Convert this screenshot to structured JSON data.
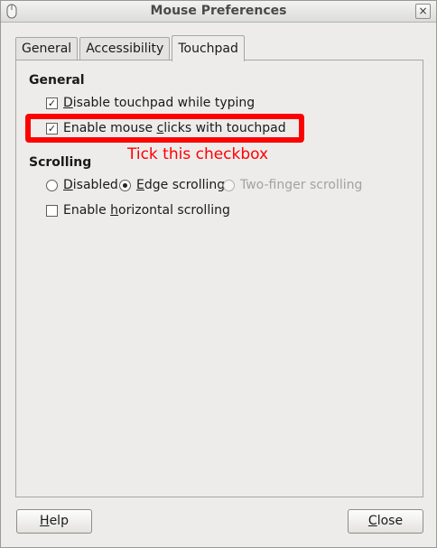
{
  "window": {
    "title": "Mouse Preferences",
    "close_glyph": "×"
  },
  "tabs": [
    {
      "label": "General",
      "active": false
    },
    {
      "label": "Accessibility",
      "active": false
    },
    {
      "label": "Touchpad",
      "active": true
    }
  ],
  "general": {
    "header": "General",
    "disable_while_typing": {
      "mnemonic": "D",
      "rest": "isable touchpad while typing",
      "checked": true
    },
    "enable_clicks": {
      "pre": "Enable mouse ",
      "mnemonic": "c",
      "post": "licks with touchpad",
      "checked": true
    }
  },
  "scrolling": {
    "header": "Scrolling",
    "disabled": {
      "mnemonic": "D",
      "rest": "isabled",
      "selected": false
    },
    "edge": {
      "mnemonic": "E",
      "rest": "dge scrolling",
      "selected": true
    },
    "two_finger": {
      "label": "Two-finger scrolling",
      "selected": false,
      "enabled": false
    },
    "horizontal": {
      "pre": "Enable ",
      "mnemonic": "h",
      "post": "orizontal scrolling",
      "checked": false
    }
  },
  "annotation": {
    "text": "Tick this checkbox",
    "color": "#ff0000"
  },
  "buttons": {
    "help": {
      "mnemonic": "H",
      "rest": "elp"
    },
    "close": {
      "mnemonic": "C",
      "rest": "lose"
    }
  },
  "icons": {
    "window_icon": "mouse-icon",
    "close": "close-icon",
    "checkbox_checked": "checkmark-icon",
    "checkbox_glyph": "✓"
  }
}
